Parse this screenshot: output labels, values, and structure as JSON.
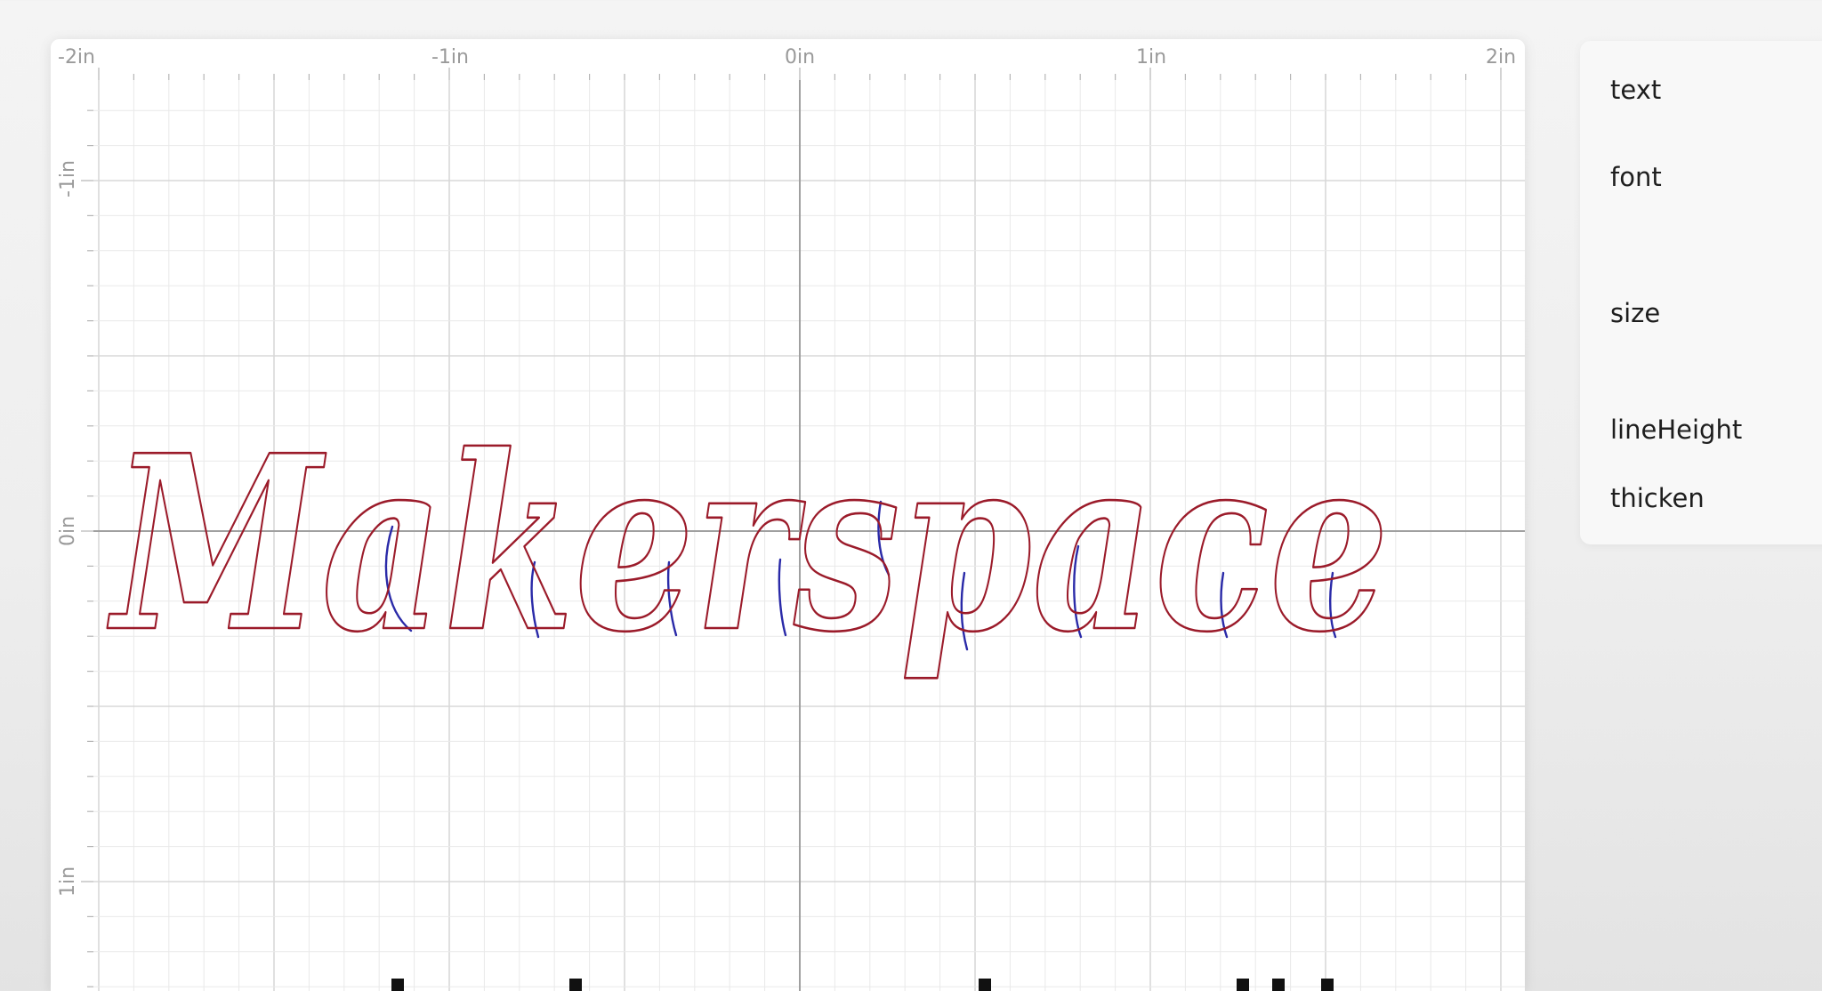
{
  "canvas": {
    "rulers": {
      "x_labels": [
        "-2in",
        "-1in",
        "0in",
        "1in",
        "2in"
      ],
      "y_labels": [
        "-1in",
        "0in",
        "1in"
      ]
    },
    "artwork": {
      "text": "Makerspace",
      "outline_color": "#9b1b2a",
      "overlap_color": "#2a2aa8"
    }
  },
  "properties": {
    "labels": [
      "text",
      "font",
      "size",
      "lineHeight",
      "thicken"
    ]
  },
  "colors": {
    "grid_minor": "#e9e9e9",
    "grid_major": "#d8d8d8",
    "axis": "#a0a0a0"
  }
}
